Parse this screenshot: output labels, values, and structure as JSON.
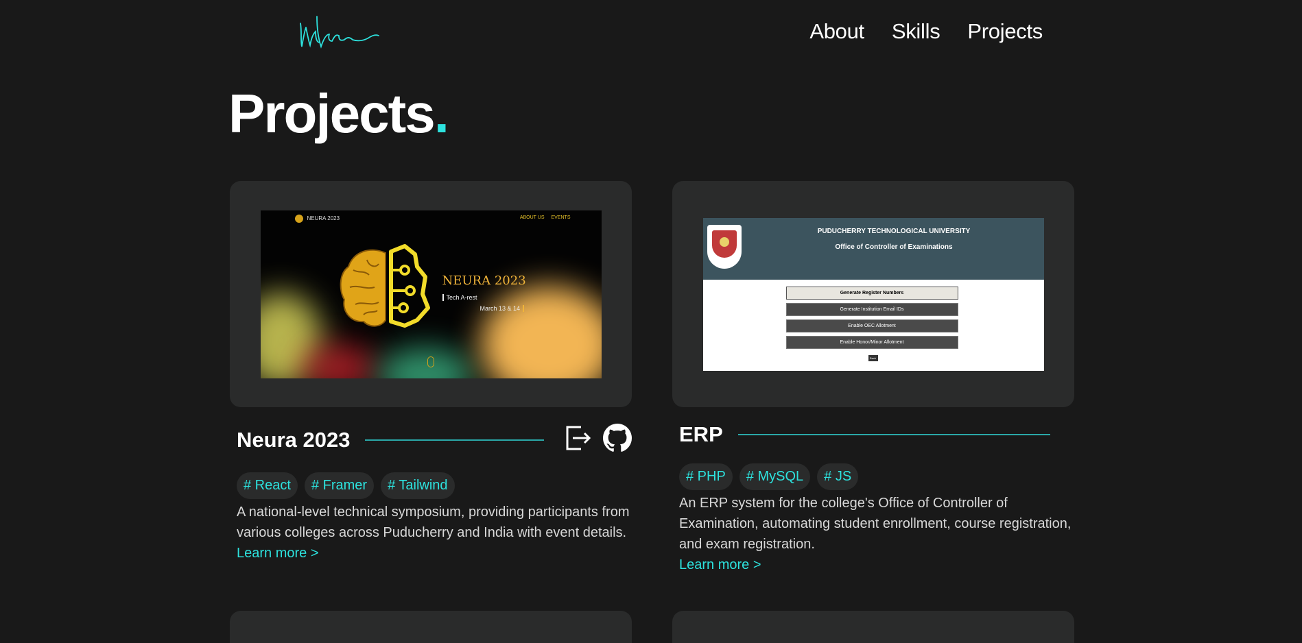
{
  "header": {
    "logo_icon": "signature-logo",
    "nav": [
      "About",
      "Skills",
      "Projects"
    ]
  },
  "page": {
    "title": "Projects",
    "title_dot": "."
  },
  "accent_color": "#2de2de",
  "projects": [
    {
      "title": "Neura 2023",
      "tags": [
        "# React",
        "# Framer",
        "# Tailwind"
      ],
      "description": "A national-level technical symposium, providing participants from various colleges across Puducherry and India with event details.",
      "learn_more": "Learn more >",
      "icons": [
        "external-link-icon",
        "github-icon"
      ],
      "thumbnail": {
        "brand": "NEURA 2023",
        "nav": [
          "ABOUT US",
          "EVENTS"
        ],
        "headline": "NEURA 2023",
        "tagline": "Tech A-rest",
        "dates": "March 13 & 14"
      }
    },
    {
      "title": "ERP",
      "tags": [
        "# PHP",
        "# MySQL",
        "# JS"
      ],
      "description": "An ERP system for the college's Office of Controller of Examination, automating student enrollment, course registration, and exam registration.",
      "learn_more": "Learn more >",
      "thumbnail": {
        "university": "PUDUCHERRY TECHNOLOGICAL UNIVERSITY",
        "office": "Office of Controller of Examinations",
        "buttons": [
          "Generate Register Numbers",
          "Generate Institution Email IDs",
          "Enable OEC Allotment",
          "Enable Honor/Minor Allotment"
        ],
        "back": "Back"
      }
    }
  ]
}
